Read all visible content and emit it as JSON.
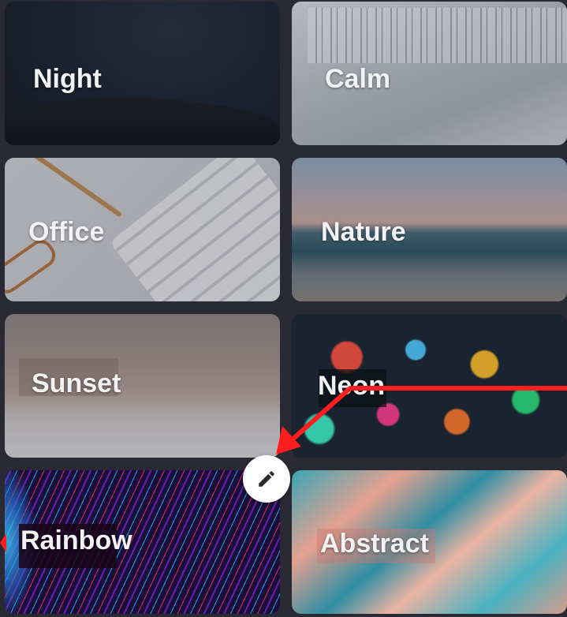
{
  "tiles": [
    {
      "id": "night",
      "label": "Night"
    },
    {
      "id": "calm",
      "label": "Calm"
    },
    {
      "id": "office",
      "label": "Office"
    },
    {
      "id": "nature",
      "label": "Nature"
    },
    {
      "id": "sunset",
      "label": "Sunset"
    },
    {
      "id": "neon",
      "label": "Neon"
    },
    {
      "id": "rainbow",
      "label": "Rainbow"
    },
    {
      "id": "abstract",
      "label": "Abstract"
    }
  ],
  "edit_button": {
    "icon": "pencil-icon"
  },
  "colors": {
    "background": "#2a2a34",
    "label_text": "#f2f2f4",
    "annotation_arrow": "#ff1e1e",
    "edit_button_bg": "#ffffff"
  }
}
